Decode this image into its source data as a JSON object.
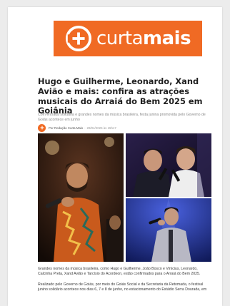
{
  "site": {
    "logo_light": "curta",
    "logo_bold": "mais",
    "brand_color": "#f06a24"
  },
  "article": {
    "title": "Hugo e Guilherme, Leonardo, Xand Avião e mais: confira as atrações musicais do Arraiá do Bem 2025 em Goiânia",
    "subtitle": "Com entrada solidária e grandes nomes da música brasileira, festa junina promovida pelo Governo de Goiás acontece em junho",
    "author": "Por Redação Curta Mais",
    "separator": "-",
    "date": "28/04/2025 às 15h17",
    "paragraphs": [
      "Grandes nomes da música brasileira, como Hugo e Guilherme, João Bosco e Vinícius, Leonardo, Calcinha Preta, Xand Avião e Tarcísio do Acordeon, estão confirmados para o Arraiá do Bem 2025.",
      "Realizado pelo Governo de Goiás, por meio do Goiás Social e da Secretaria da Retomada, o festival junino solidário acontece nos dias 6, 7 e 8 de junho, no estacionamento do Estádio Serra Dourada, em"
    ]
  },
  "photos": [
    {
      "name": "singer-with-microphone",
      "icon": "photo"
    },
    {
      "name": "duo-singing",
      "icon": "photo"
    },
    {
      "name": "singer-in-blue-stage",
      "icon": "photo"
    }
  ]
}
